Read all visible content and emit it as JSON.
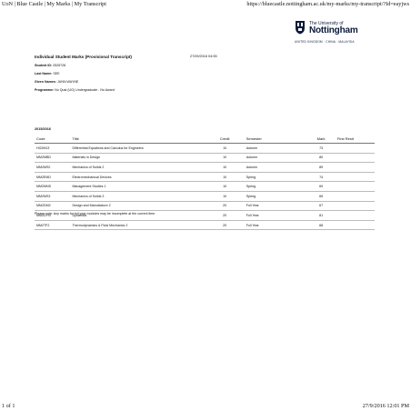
{
  "print_header": {
    "page_title": "UoN | Blue Castle | My Marks | My Transcript",
    "url": "https://bluecastle.nottingham.ac.uk/my-marks/my-transcript/?Id=eayjws"
  },
  "print_footer": {
    "page_count": "1 of 1",
    "printed_at": "27/9/2016 12:01 PM"
  },
  "logo": {
    "line1": "The University of",
    "line2": "Nottingham",
    "line3": "UNITED KINGDOM · CHINA · MALAYSIA"
  },
  "document": {
    "title": "Individual Student Marks (Provisional Transcript)",
    "date": "27/09/2016 04:55",
    "student_id_label": "Student ID:",
    "student_id": "2525728",
    "last_name_label": "Last Name:",
    "last_name": "SEE",
    "given_names_label": "Given Names:",
    "given_names": "JUNN WAYNE",
    "programme_label": "Programme:",
    "programme": "No Qual (UG) Undergraduate - No Award",
    "year": "2015/2016",
    "table": {
      "headers": {
        "code": "Code",
        "title": "Title",
        "credit": "Credit",
        "semester": "Semester",
        "mark": "Mark",
        "first_resit": "First Resit"
      },
      "rows": [
        {
          "code": "HG2M13",
          "title": "Differential Equations and Calculus for Engineers",
          "credit": "10",
          "semester": "Autumn",
          "mark": "73",
          "first_resit": ""
        },
        {
          "code": "MM2MBD",
          "title": "Materials in Design",
          "credit": "10",
          "semester": "Autumn",
          "mark": "80",
          "first_resit": ""
        },
        {
          "code": "MM2MS2",
          "title": "Mechanics of Solids 2",
          "credit": "10",
          "semester": "Autumn",
          "mark": "89",
          "first_resit": ""
        },
        {
          "code": "MM2EMD",
          "title": "Electromechanical Devices",
          "credit": "10",
          "semester": "Spring",
          "mark": "74",
          "first_resit": ""
        },
        {
          "code": "MM2MNS",
          "title": "Management Studies 1",
          "credit": "10",
          "semester": "Spring",
          "mark": "69",
          "first_resit": ""
        },
        {
          "code": "MM2MS3",
          "title": "Mechanics of Solids 3",
          "credit": "10",
          "semester": "Spring",
          "mark": "65",
          "first_resit": ""
        },
        {
          "code": "MM2DM2",
          "title": "Design and Manufacture 2",
          "credit": "20",
          "semester": "Full Year",
          "mark": "67",
          "first_resit": ""
        },
        {
          "code": "MM2DYN",
          "title": "Dynamics",
          "credit": "20",
          "semester": "Full Year",
          "mark": "81",
          "first_resit": ""
        },
        {
          "code": "MM2TF2",
          "title": "Thermodynamics & Fluid Mechanics 2",
          "credit": "20",
          "semester": "Full Year",
          "mark": "68",
          "first_resit": ""
        }
      ]
    },
    "note": "Please note: Any marks for full year modules may be incomplete at the current time"
  }
}
